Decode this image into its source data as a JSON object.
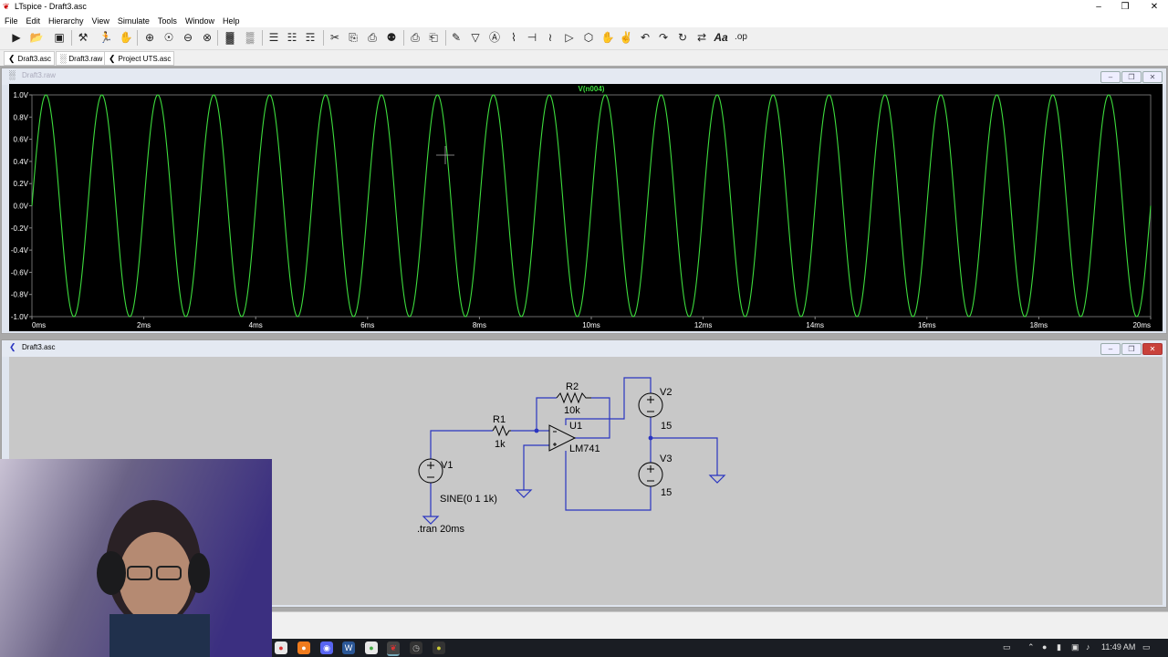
{
  "app": {
    "title": "LTspice - Draft3.asc",
    "colors": {
      "trace": "#3ddc3d",
      "wire": "#2a35c0",
      "plot_bg": "#000000",
      "schematic_bg": "#c8c8c8"
    }
  },
  "menu": [
    "File",
    "Edit",
    "Hierarchy",
    "View",
    "Simulate",
    "Tools",
    "Window",
    "Help"
  ],
  "toolbar": {
    "icons": [
      "new-schematic",
      "open",
      "save",
      "control-panel",
      "run",
      "halt",
      "zoom-in",
      "pan",
      "zoom-out",
      "zoom-full",
      "autorange",
      "tile-horizontal",
      "tile-vertical",
      "cascade",
      "cut",
      "copy",
      "paste",
      "find",
      "print",
      "print-preview",
      "draw-wire",
      "ground",
      "label-net",
      "resistor",
      "capacitor",
      "inductor",
      "diode",
      "component",
      "move",
      "drag",
      "undo",
      "redo",
      "rotate",
      "mirror",
      "text",
      "spice-directive"
    ],
    "text_tool": "Aa",
    "op_tool": ".op"
  },
  "tabs": [
    {
      "label": "Draft3.asc",
      "icon": "schematic-icon"
    },
    {
      "label": "Draft3.raw",
      "icon": "waveform-icon"
    },
    {
      "label": "Project UTS.asc",
      "icon": "schematic-icon"
    }
  ],
  "waveform_window": {
    "title": "Draft3.raw",
    "trace_label": "V(n004)"
  },
  "schematic_window": {
    "title": "Draft3.asc"
  },
  "chart_data": {
    "type": "line",
    "series": [
      {
        "name": "V(n004)",
        "frequency_hz": 1000,
        "amplitude_v": 1.0,
        "offset_v": 0
      }
    ],
    "x_ticks": [
      "0ms",
      "2ms",
      "4ms",
      "6ms",
      "8ms",
      "10ms",
      "12ms",
      "14ms",
      "16ms",
      "18ms",
      "20ms"
    ],
    "y_ticks": [
      "1.0V",
      "0.8V",
      "0.6V",
      "0.4V",
      "0.2V",
      "0.0V",
      "-0.2V",
      "-0.4V",
      "-0.6V",
      "-0.8V",
      "-1.0V"
    ],
    "xlim": [
      0,
      20
    ],
    "ylim": [
      -1.0,
      1.0
    ],
    "grid": false
  },
  "schematic": {
    "r2": {
      "name": "R2",
      "value": "10k"
    },
    "r1": {
      "name": "R1",
      "value": "1k"
    },
    "u1": {
      "name": "U1",
      "model": "LM741"
    },
    "v1": {
      "name": "V1",
      "value": "SINE(0 1 1k)"
    },
    "v2": {
      "name": "V2",
      "value": "15"
    },
    "v3": {
      "name": "V3",
      "value": "15"
    },
    "directive": ".tran 20ms"
  },
  "tray": {
    "time": "11:49 AM"
  }
}
